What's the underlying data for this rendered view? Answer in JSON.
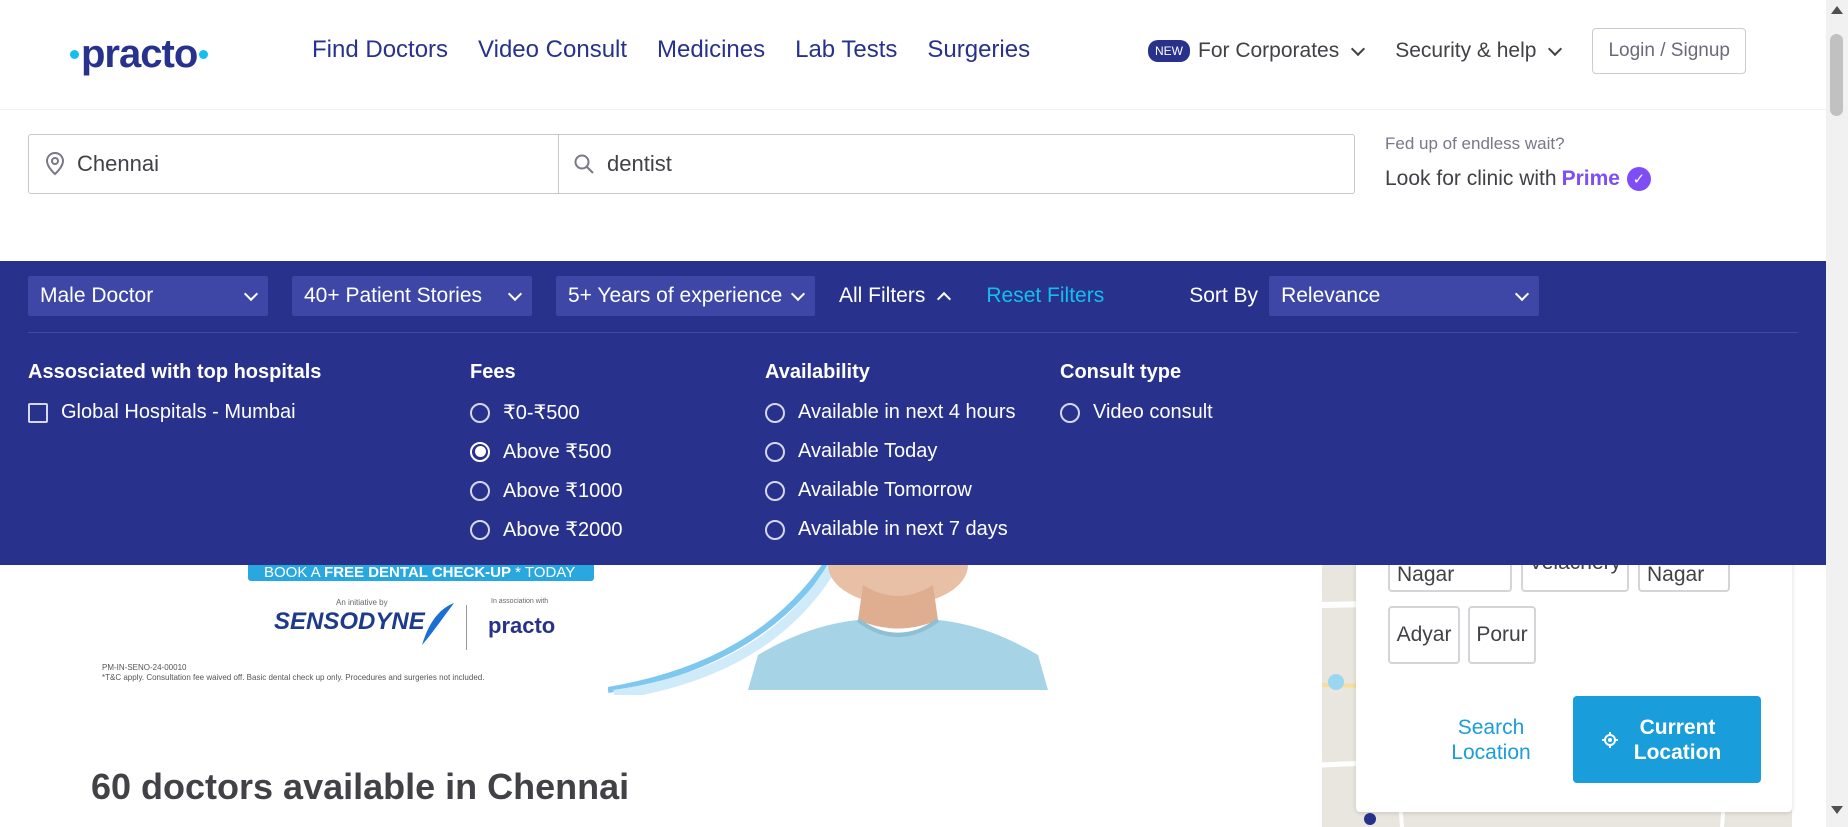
{
  "brand": {
    "logo": "practo",
    "primary_color": "#28328c",
    "accent_color": "#14bef0"
  },
  "header": {
    "nav": [
      "Find Doctors",
      "Video Consult",
      "Medicines",
      "Lab Tests",
      "Surgeries"
    ],
    "new_badge": "NEW",
    "corporates": "For Corporates",
    "security": "Security & help",
    "login": "Login / Signup"
  },
  "search": {
    "location": "Chennai",
    "query": "dentist"
  },
  "prime": {
    "small": "Fed up of endless wait?",
    "text": "Look for clinic with",
    "prime": "Prime"
  },
  "filters": {
    "gender": "Male Doctor",
    "stories": "40+ Patient Stories",
    "experience": "5+ Years of experience",
    "all_filters": "All Filters",
    "reset": "Reset Filters",
    "sort_label": "Sort By",
    "sort_value": "Relevance",
    "hospitals": {
      "title": "Assosciated with top hospitals",
      "options": [
        "Global Hospitals - Mumbai"
      ]
    },
    "fees": {
      "title": "Fees",
      "options": [
        "₹0-₹500",
        "Above ₹500",
        "Above ₹1000",
        "Above ₹2000"
      ],
      "selected": "Above ₹500"
    },
    "availability": {
      "title": "Availability",
      "options": [
        "Available in next 4 hours",
        "Available Today",
        "Available Tomorrow",
        "Available in next 7 days"
      ]
    },
    "consult": {
      "title": "Consult type",
      "options": [
        "Video consult"
      ]
    }
  },
  "banner": {
    "book_prefix": "BOOK A",
    "book_bold": "FREE DENTAL CHECK-UP",
    "book_suffix": "* TODAY",
    "initiative": "An initiative by",
    "brand": "SENSODYNE",
    "association": "In association with",
    "partner": "practo",
    "code": "PM-IN-SENO-24-00010",
    "disclaimer": "*T&C apply. Consultation fee waived off. Basic dental check up only. Procedures and surgeries not included."
  },
  "results": {
    "title": "60 doctors available in Chennai"
  },
  "map_panel": {
    "localities": [
      "Anna Nagar",
      "Velachery",
      "T Nagar",
      "Adyar",
      "Porur"
    ],
    "search_location": "Search Location",
    "current_location": "Current Location"
  }
}
